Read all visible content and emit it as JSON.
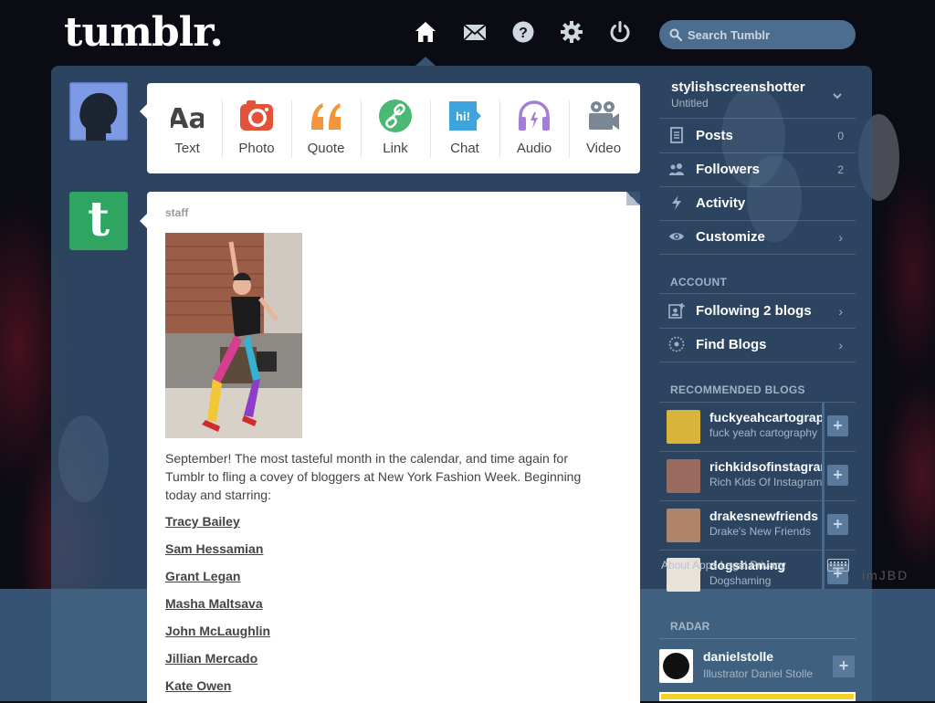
{
  "header": {
    "logo": "tumblr.",
    "nav": [
      "home-icon",
      "mail-icon",
      "help-icon",
      "gear-icon",
      "power-icon"
    ],
    "search": {
      "placeholder": "Search Tumblr"
    }
  },
  "post_form": {
    "items": [
      {
        "label": "Text",
        "icon": "text-icon"
      },
      {
        "label": "Photo",
        "icon": "camera-icon"
      },
      {
        "label": "Quote",
        "icon": "quote-icon"
      },
      {
        "label": "Link",
        "icon": "link-icon"
      },
      {
        "label": "Chat",
        "icon": "chat-icon"
      },
      {
        "label": "Audio",
        "icon": "headphones-icon"
      },
      {
        "label": "Video",
        "icon": "video-camera-icon"
      }
    ],
    "icon_text": {
      "text": "Aa",
      "chat": "hi!"
    },
    "colors": {
      "text": "#444444",
      "photo": "#e2533a",
      "quote": "#f3963a",
      "link": "#4ab975",
      "chat": "#3fa3dd",
      "audio": "#a47ed7",
      "video": "#7a8896"
    }
  },
  "post": {
    "author": "staff",
    "body": "September! The most tasteful month in the calendar, and time again for Tumblr to fling a covey of bloggers at New York Fashion Week. Beginning today and starring:",
    "links": [
      "Tracy Bailey",
      "Sam Hessamian",
      "Grant Legan",
      "Masha Maltsava",
      "John McLaughlin",
      "Jillian Mercado",
      "Kate Owen"
    ]
  },
  "sidebar": {
    "blog_name": "stylishscreenshotter",
    "blog_subtitle": "Untitled",
    "items": [
      {
        "label": "Posts",
        "count": "0",
        "icon": "posts-icon"
      },
      {
        "label": "Followers",
        "count": "2",
        "icon": "followers-icon"
      },
      {
        "label": "Activity",
        "icon": "lightning-icon"
      },
      {
        "label": "Customize",
        "icon": "eye-icon"
      }
    ],
    "account_heading": "ACCOUNT",
    "account_items": [
      {
        "label": "Following 2 blogs",
        "icon": "following-icon"
      },
      {
        "label": "Find Blogs",
        "icon": "compass-icon"
      }
    ],
    "recommended_heading": "RECOMMENDED BLOGS",
    "recommended": [
      {
        "name": "fuckyeahcartography",
        "desc": "fuck yeah cartography",
        "color": "#d9b43a"
      },
      {
        "name": "richkidsofinstagram",
        "desc": "Rich Kids Of Instagram",
        "color": "#9a6b5e"
      },
      {
        "name": "drakesnewfriends",
        "desc": "Drake's New Friends",
        "color": "#b0846a"
      },
      {
        "name": "dogshaming",
        "desc": "Dogshaming",
        "color": "#e8e2d8"
      }
    ],
    "follow_symbol": "+",
    "footer_links": "About  Apps  Legal  Privacy",
    "watermark": "imJBD",
    "radar": {
      "heading": "RADAR",
      "name": "danielstolle",
      "desc": "Illustrator Daniel Stolle",
      "follow_symbol": "+"
    }
  }
}
